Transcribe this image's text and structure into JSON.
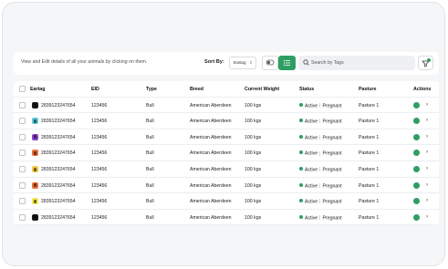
{
  "toolbar": {
    "hint": "View and Edit details of all your animals by clicking on them.",
    "sort_label": "Sort By:",
    "sort_value": "Eartag",
    "search_placeholder": "Search by Tags"
  },
  "table": {
    "columns": [
      "Eartag",
      "EID",
      "Type",
      "Breed",
      "Current Weight",
      "Status",
      "Pasture",
      "Actions"
    ],
    "rows": [
      {
        "tag_color": "#1a1a1a",
        "eartag": "2839123247654",
        "eid": "123456",
        "type": "Bull",
        "breed": "American Aberdeen",
        "weight": "100 kgs",
        "status": "Active",
        "status2": "Pregnant",
        "pasture": "Pasture 1"
      },
      {
        "tag_color": "#5bc8d8",
        "eartag": "2839123247654",
        "eid": "123456",
        "type": "Bull",
        "breed": "American Aberdeen",
        "weight": "100 kgs",
        "status": "Active",
        "status2": "Pregnant",
        "pasture": "Pasture 1"
      },
      {
        "tag_color": "#8e44c9",
        "eartag": "2839123247654",
        "eid": "123456",
        "type": "Bull",
        "breed": "American Aberdeen",
        "weight": "100 kgs",
        "status": "Active",
        "status2": "Pregnant",
        "pasture": "Pasture 1"
      },
      {
        "tag_color": "#e8703a",
        "eartag": "2839123247654",
        "eid": "123456",
        "type": "Bull",
        "breed": "American Aberdeen",
        "weight": "100 kgs",
        "status": "Active",
        "status2": "Pregnant",
        "pasture": "Pasture 1"
      },
      {
        "tag_color": "#f2c94c",
        "eartag": "2839123247654",
        "eid": "123456",
        "type": "Bull",
        "breed": "American Aberdeen",
        "weight": "100 kgs",
        "status": "Active",
        "status2": "Pregnant",
        "pasture": "Pasture 1"
      },
      {
        "tag_color": "#e8703a",
        "eartag": "2839123247654",
        "eid": "123456",
        "type": "Bull",
        "breed": "American Aberdeen",
        "weight": "100 kgs",
        "status": "Active",
        "status2": "Pregnant",
        "pasture": "Pasture 1"
      },
      {
        "tag_color": "#f2e84c",
        "eartag": "2839123247654",
        "eid": "123456",
        "type": "Bull",
        "breed": "American Aberdeen",
        "weight": "100 kgs",
        "status": "Active",
        "status2": "Pregnant",
        "pasture": "Pasture 1"
      },
      {
        "tag_color": "#1a1a1a",
        "eartag": "2839123247654",
        "eid": "123456",
        "type": "Bull",
        "breed": "American Aberdeen",
        "weight": "100 kgs",
        "status": "Active",
        "status2": "Pregnant",
        "pasture": "Pasture 1"
      }
    ]
  },
  "colors": {
    "accent": "#2f9e64"
  },
  "icons": [
    "chevron-down-icon",
    "toggle-icon",
    "list-icon",
    "search-icon",
    "filter-icon",
    "chevron-right-icon"
  ]
}
